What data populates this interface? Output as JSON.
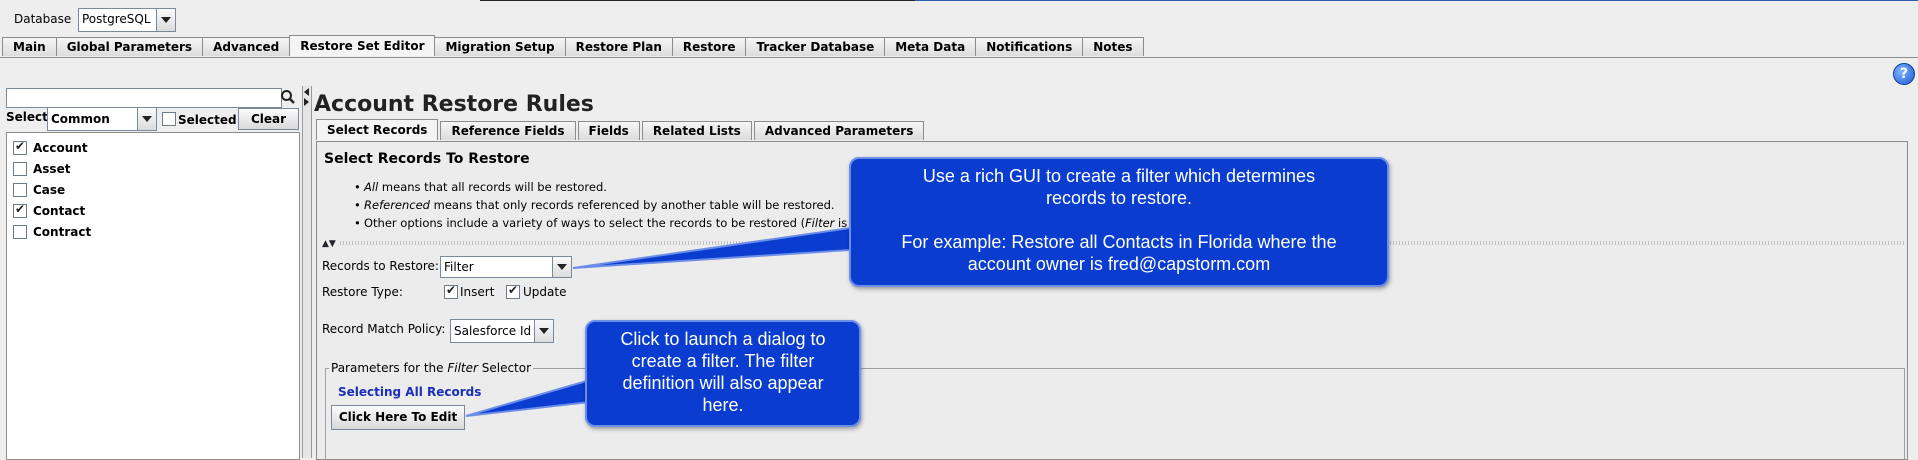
{
  "database": {
    "label": "Database",
    "value": "PostgreSQL"
  },
  "main_tabs": [
    {
      "label": "Main",
      "active": false
    },
    {
      "label": "Global Parameters",
      "active": false
    },
    {
      "label": "Advanced",
      "active": false
    },
    {
      "label": "Restore Set Editor",
      "active": true
    },
    {
      "label": "Migration Setup",
      "active": false
    },
    {
      "label": "Restore Plan",
      "active": false
    },
    {
      "label": "Restore",
      "active": false
    },
    {
      "label": "Tracker Database",
      "active": false
    },
    {
      "label": "Meta Data",
      "active": false
    },
    {
      "label": "Notifications",
      "active": false
    },
    {
      "label": "Notes",
      "active": false
    }
  ],
  "help": {
    "glyph": "?"
  },
  "left_panel": {
    "search_placeholder": "",
    "select_label": "Select:",
    "select_value": "Common",
    "selected_label": "Selected",
    "clear_label": "Clear",
    "items": [
      {
        "label": "Account",
        "checked": true
      },
      {
        "label": "Asset",
        "checked": false
      },
      {
        "label": "Case",
        "checked": false
      },
      {
        "label": "Contact",
        "checked": true
      },
      {
        "label": "Contract",
        "checked": false
      }
    ]
  },
  "page_title": "Account Restore Rules",
  "sub_tabs": [
    {
      "label": "Select Records",
      "active": true
    },
    {
      "label": "Reference Fields",
      "active": false
    },
    {
      "label": "Fields",
      "active": false
    },
    {
      "label": "Related Lists",
      "active": false
    },
    {
      "label": "Advanced Parameters",
      "active": false
    }
  ],
  "select_records": {
    "section_title": "Select Records To Restore",
    "bullets": [
      {
        "em": "All",
        "rest": " means that all records will be restored."
      },
      {
        "em": "Referenced",
        "rest": " means that only records referenced by another table will be restored."
      },
      {
        "em": "",
        "rest": "Other options include a variety of ways to select the records to be restored (",
        "em2": "Filter",
        "rest2": " is ofte"
      }
    ],
    "records_to_restore_label": "Records to Restore:",
    "records_to_restore_value": "Filter",
    "restore_type_label": "Restore Type:",
    "insert_label": "Insert",
    "update_label": "Update",
    "record_match_label": "Record Match Policy:",
    "record_match_value": "Salesforce Id",
    "params_prefix": "Parameters for the ",
    "params_em": "Filter",
    "params_suffix": " Selector",
    "selecting_all": "Selecting All Records",
    "edit_button": "Click Here To Edit"
  },
  "callouts": {
    "filter": {
      "line1": "Use a rich GUI to create a filter which determines",
      "line2": "records to restore.",
      "line3": "For example: Restore all Contacts in Florida where the",
      "line4": "account owner is fred@capstorm.com"
    },
    "edit": {
      "line1": "Click to launch a dialog to",
      "line2": "create a filter. The filter",
      "line3": "definition will also appear",
      "line4": "here."
    }
  },
  "colors": {
    "callout_bg": "#0a3ccf",
    "link_blue": "#1b2fb8"
  }
}
